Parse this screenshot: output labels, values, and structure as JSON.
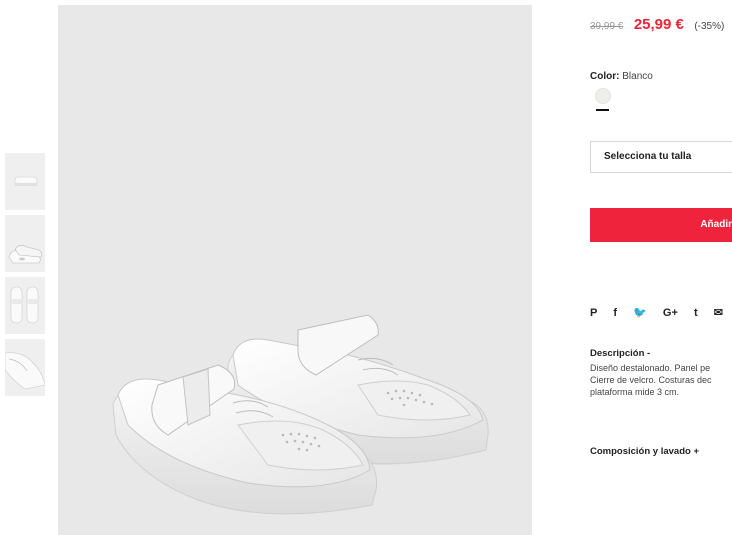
{
  "product": {
    "old_price": "39,99 €",
    "sale_price": "25,99 €",
    "discount": "(-35%)",
    "color_label": "Color:",
    "color_value": "Blanco",
    "swatch_color": "#eeeeea",
    "size_placeholder": "Selecciona tu talla",
    "add_button": "Añadir",
    "description_title": "Descripción -",
    "description_lines": [
      "Diseño destalonado. Panel pe",
      "Cierre de velcro. Costuras dec",
      "plataforma mide 3 cm."
    ],
    "composition_title": "Composición y lavado +"
  },
  "social": {
    "icons": [
      "pinterest-icon",
      "facebook-icon",
      "twitter-icon",
      "google-plus-icon",
      "tumblr-icon",
      "mail-icon"
    ],
    "glyphs": [
      "P",
      "f",
      "🐦",
      "G+",
      "t",
      "✉"
    ]
  },
  "colors": {
    "accent": "#ef233c",
    "price": "#e9253a",
    "image_bg": "#e8e8e8"
  }
}
